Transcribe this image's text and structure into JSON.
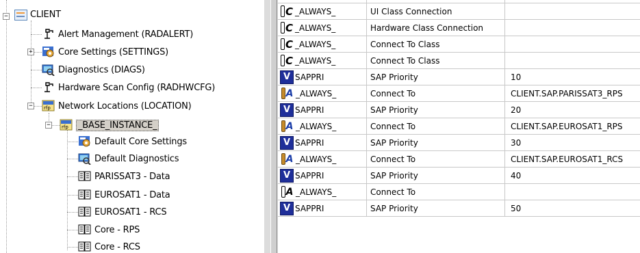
{
  "tree": {
    "expander_plus": "+",
    "expander_minus": "−",
    "root": {
      "label": "CLIENT",
      "icon": "client-icon"
    },
    "items": [
      {
        "label": "Alert Management (RADALERT)",
        "icon": "plug-icon"
      },
      {
        "label": "Core Settings (SETTINGS)",
        "icon": "gear-icon"
      },
      {
        "label": "Diagnostics (DIAGS)",
        "icon": "diagnostics-icon"
      },
      {
        "label": "Hardware Scan Config (RADHWCFG)",
        "icon": "plug-icon"
      },
      {
        "label": "Network Locations (LOCATION)",
        "icon": "network-icon"
      },
      {
        "label": "_BASE_INSTANCE_",
        "icon": "network-icon"
      },
      {
        "label": "Default Core Settings",
        "icon": "gear-icon"
      },
      {
        "label": "Default Diagnostics",
        "icon": "diagnostics-icon"
      },
      {
        "label": "PARISSAT3 - Data",
        "icon": "document-icon"
      },
      {
        "label": "EUROSAT1 - Data",
        "icon": "document-icon"
      },
      {
        "label": "EUROSAT1 - RCS",
        "icon": "document-icon"
      },
      {
        "label": "Core - RPS",
        "icon": "document-icon"
      },
      {
        "label": "Core - RCS",
        "icon": "document-icon"
      }
    ]
  },
  "grid": {
    "rows": [
      {
        "type": "C",
        "name": "_ALWAYS_",
        "desc": "UI Class Connection",
        "value": ""
      },
      {
        "type": "C",
        "name": "_ALWAYS_",
        "desc": "Hardware Class Connection",
        "value": ""
      },
      {
        "type": "C",
        "name": "_ALWAYS_",
        "desc": "Connect To Class",
        "value": ""
      },
      {
        "type": "C",
        "name": "_ALWAYS_",
        "desc": "Connect To Class",
        "value": ""
      },
      {
        "type": "V",
        "name": "SAPPRI",
        "desc": "SAP Priority",
        "value": "10"
      },
      {
        "type": "A",
        "name": "_ALWAYS_",
        "desc": "Connect To",
        "value": "CLIENT.SAP.PARISSAT3_RPS"
      },
      {
        "type": "V",
        "name": "SAPPRI",
        "desc": "SAP Priority",
        "value": "20"
      },
      {
        "type": "A",
        "name": "_ALWAYS_",
        "desc": "Connect To",
        "value": "CLIENT.SAP.EUROSAT1_RPS"
      },
      {
        "type": "V",
        "name": "SAPPRI",
        "desc": "SAP Priority",
        "value": "30"
      },
      {
        "type": "A",
        "name": "_ALWAYS_",
        "desc": "Connect To",
        "value": "CLIENT.SAP.EUROSAT1_RCS"
      },
      {
        "type": "V",
        "name": "SAPPRI",
        "desc": "SAP Priority",
        "value": "40"
      },
      {
        "type": "A0",
        "name": "_ALWAYS_",
        "desc": "Connect To",
        "value": ""
      },
      {
        "type": "V",
        "name": "SAPPRI",
        "desc": "SAP Priority",
        "value": "50"
      }
    ]
  }
}
